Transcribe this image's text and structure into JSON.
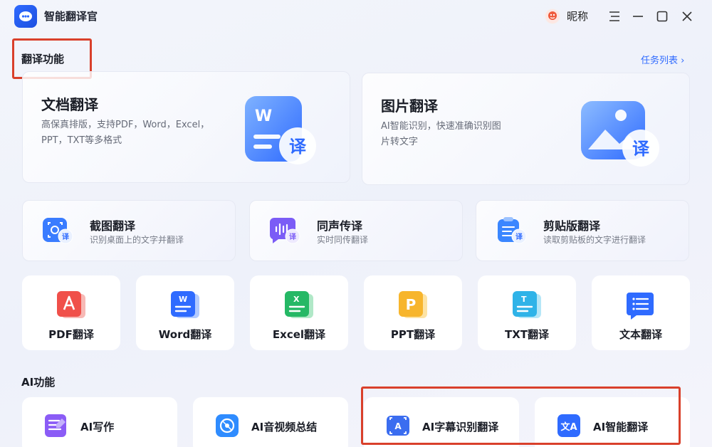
{
  "app": {
    "title": "智能翻译官",
    "user_name": "昵称"
  },
  "translate_section": {
    "title": "翻译功能",
    "task_link": "任务列表 ›",
    "doc_card": {
      "title": "文档翻译",
      "desc": "高保真排版，支持PDF，Word，Excel，PPT，TXT等多格式",
      "badge": "译",
      "doc_letter": "W"
    },
    "image_card": {
      "title": "图片翻译",
      "desc": "AI智能识别，快速准确识别图片转文字",
      "badge": "译"
    },
    "screenshot_card": {
      "title": "截图翻译",
      "desc": "识别桌面上的文字并翻译",
      "badge": "译"
    },
    "simultaneous_card": {
      "title": "同声传译",
      "desc": "实时同传翻译",
      "badge": "译"
    },
    "clipboard_card": {
      "title": "剪贴版翻译",
      "desc": "读取剪贴板的文字进行翻译",
      "badge": "译"
    },
    "tools": [
      {
        "label": "PDF翻译",
        "icon": "pdf-icon",
        "color": "#f0504a",
        "glyph": "⅄"
      },
      {
        "label": "Word翻译",
        "icon": "word-icon",
        "color": "#2f6bff",
        "glyph": "W"
      },
      {
        "label": "Excel翻译",
        "icon": "excel-icon",
        "color": "#25b865",
        "glyph": "X"
      },
      {
        "label": "PPT翻译",
        "icon": "ppt-icon",
        "color": "#f7b52c",
        "glyph": "P"
      },
      {
        "label": "TXT翻译",
        "icon": "txt-icon",
        "color": "#2fb3e8",
        "glyph": "T"
      },
      {
        "label": "文本翻译",
        "icon": "text-icon",
        "color": "#2f6bff",
        "glyph": "≡"
      }
    ]
  },
  "ai_section": {
    "title": "AI功能",
    "items": [
      {
        "label": "AI写作",
        "icon": "ai-writing-icon",
        "color": "#8b5cf6"
      },
      {
        "label": "AI音视频总结",
        "icon": "ai-media-summary-icon",
        "color": "#2f8cff"
      },
      {
        "label": "AI字幕识别翻译",
        "icon": "ai-subtitle-icon",
        "color": "#3b6df0",
        "glyph": "A"
      },
      {
        "label": "AI智能翻译",
        "icon": "ai-smart-translate-icon",
        "color": "#2f6bff",
        "glyph": "文A"
      }
    ]
  },
  "colors": {
    "accent": "#2f6bff",
    "highlight": "#d9402b"
  }
}
